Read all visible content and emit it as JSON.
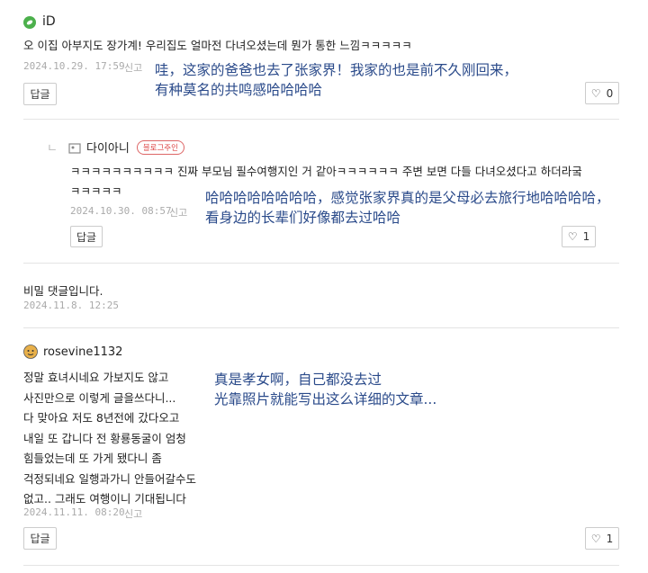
{
  "comments": [
    {
      "username": "iD",
      "avatar_icon": "green-leaf-avatar",
      "text_lines": [
        "오 이집 아부지도 장가계! 우리집도 얼마전 다녀오셨는데 뭔가 통한 느낌ㅋㅋㅋㅋㅋ"
      ],
      "date": "2024.10.29. 17:59",
      "report_label": "신고",
      "annotation_lines": [
        "哇，这家的爸爸也去了张家界！我家的也是前不久刚回来，",
        "有种莫名的共鸣感哈哈哈哈"
      ],
      "reply_label": "답글",
      "likes": "0"
    },
    {
      "username": "다이아니",
      "badge": "블로그주인",
      "reply_marker": "ㄴ",
      "text_lines": [
        "ㅋㅋㅋㅋㅋㅋㅋㅋㅋㅋ 진짜 부모님 필수여행지인 거 같아ㅋㅋㅋㅋㅋㅋ 주변 보면 다들 다녀오셨다고 하더라궄",
        "ㅋㅋㅋㅋㅋ"
      ],
      "date": "2024.10.30. 08:57",
      "report_label": "신고",
      "annotation_lines": [
        "哈哈哈哈哈哈哈哈，感觉张家界真的是父母必去旅行地哈哈哈哈，",
        "看身边的长辈们好像都去过哈哈"
      ],
      "reply_label": "답글",
      "likes": "1"
    },
    {
      "text_lines": [
        "비밀 댓글입니다."
      ],
      "date": "2024.11.8. 12:25"
    },
    {
      "username": "rosevine1132",
      "text_lines": [
        "정말 효녀시네요 가보지도 않고",
        "사진만으로 이렇게 글을쓰다니...",
        "다 맞아요 저도 8년전에 갔다오고",
        "내일 또 갑니다 전 황룡동굴이 엄청",
        "힘들었는데 또 가게 됐다니 좀",
        "걱정되네요 일행과가니 안들어갈수도",
        "없고.. 그래도 여행이니 기대됩니다"
      ],
      "date": "2024.11.11. 08:20",
      "report_label": "신고",
      "annotation_lines": [
        "真是孝女啊，自己都没去过",
        "光靠照片就能写出这么详细的文章..."
      ],
      "reply_label": "답글",
      "likes": "1"
    }
  ]
}
